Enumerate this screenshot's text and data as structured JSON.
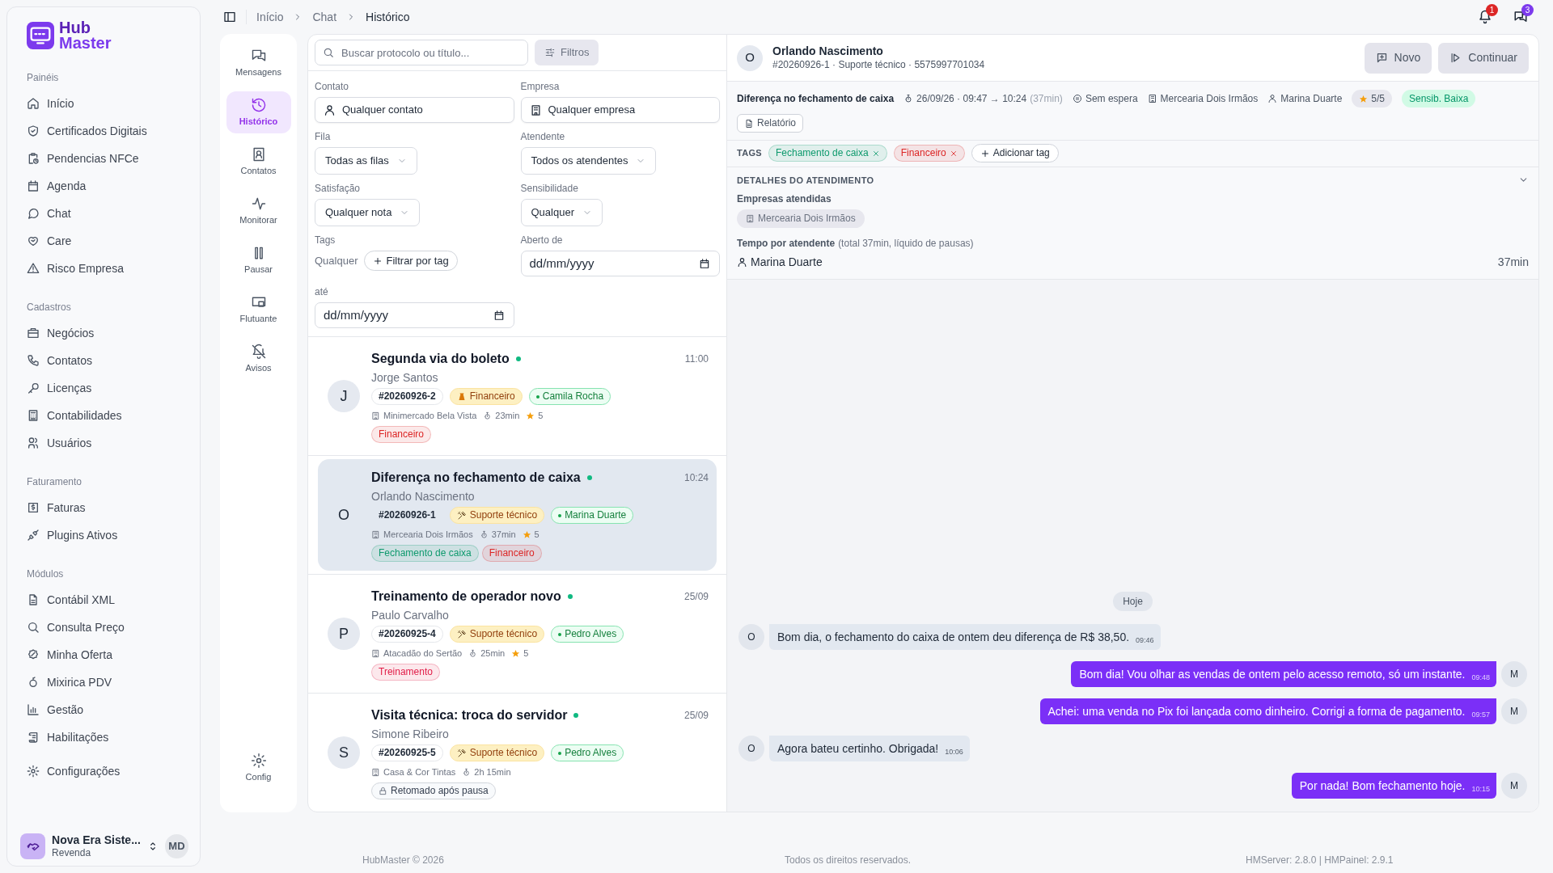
{
  "topbar": {
    "breadcrumbs": [
      "Início",
      "Chat",
      "Histórico"
    ],
    "notification_count": "1",
    "message_count": "3"
  },
  "sidebar": {
    "logo": {
      "line1": "Hub",
      "line2": "Master"
    },
    "sections": [
      {
        "title": "Painéis",
        "items": [
          "Início",
          "Certificados Digitais",
          "Pendencias NFCe",
          "Agenda",
          "Chat",
          "Care",
          "Risco Empresa"
        ]
      },
      {
        "title": "Cadastros",
        "items": [
          "Negócios",
          "Contatos",
          "Licenças",
          "Contabilidades",
          "Usuários"
        ]
      },
      {
        "title": "Faturamento",
        "items": [
          "Faturas",
          "Plugins Ativos"
        ]
      },
      {
        "title": "Módulos",
        "items": [
          "Contábil XML",
          "Consulta Preço",
          "Minha Oferta",
          "Mixirica PDV",
          "Gestão",
          "Habilitações"
        ]
      }
    ],
    "settings": "Configurações",
    "account": {
      "name": "Nova Era Siste...",
      "role": "Revenda",
      "initials": "MD"
    }
  },
  "rail": {
    "items": [
      {
        "label": "Mensagens",
        "selected": false
      },
      {
        "label": "Histórico",
        "selected": true
      },
      {
        "label": "Contatos",
        "selected": false
      },
      {
        "label": "Monitorar",
        "selected": false
      },
      {
        "label": "Pausar",
        "selected": false
      },
      {
        "label": "Flutuante",
        "selected": false
      },
      {
        "label": "Avisos",
        "selected": false
      }
    ],
    "settings": "Config"
  },
  "filters": {
    "search_placeholder": "Buscar protocolo ou título...",
    "filters_button": "Filtros",
    "contact": {
      "label": "Contato",
      "value": "Qualquer contato"
    },
    "company": {
      "label": "Empresa",
      "value": "Qualquer empresa"
    },
    "queue": {
      "label": "Fila",
      "value": "Todas as filas"
    },
    "agent": {
      "label": "Atendente",
      "value": "Todos os atendentes"
    },
    "satisfaction": {
      "label": "Satisfação",
      "value": "Qualquer nota"
    },
    "sensitivity": {
      "label": "Sensibilidade",
      "value": "Qualquer"
    },
    "tags": {
      "label": "Tags",
      "value": "Qualquer",
      "button": "Filtrar por tag"
    },
    "opened_from": {
      "label": "Aberto de",
      "placeholder": "dd/mm/yyyy"
    },
    "until": {
      "label": "até",
      "placeholder": "dd/mm/yyyy"
    }
  },
  "conversations": [
    {
      "avatar": "J",
      "title": "Segunda via do boleto",
      "online": true,
      "contact": "Jorge Santos",
      "time": "11:00",
      "protocol": "#20260926-2",
      "queue": {
        "kind": "finance",
        "label": "Financeiro"
      },
      "agent": "Camila Rocha",
      "company": "Minimercado Bela Vista",
      "duration": "23min",
      "rating": "5",
      "tags": [
        {
          "kind": "tag",
          "label": "Financeiro",
          "color": "#dc2626"
        }
      ],
      "selected": false
    },
    {
      "avatar": "O",
      "title": "Diferença no fechamento de caixa",
      "online": true,
      "contact": "Orlando Nascimento",
      "time": "10:24",
      "protocol": "#20260926-1",
      "queue": {
        "kind": "support",
        "label": "Suporte técnico"
      },
      "agent": "Marina Duarte",
      "company": "Mercearia Dois Irmãos",
      "duration": "37min",
      "rating": "5",
      "tags": [
        {
          "kind": "tag",
          "label": "Fechamento de caixa",
          "color": "#0f9a6e"
        },
        {
          "kind": "tag",
          "label": "Financeiro",
          "color": "#dc2626"
        }
      ],
      "selected": true
    },
    {
      "avatar": "P",
      "title": "Treinamento de operador novo",
      "online": true,
      "contact": "Paulo Carvalho",
      "time": "25/09",
      "protocol": "#20260925-4",
      "queue": {
        "kind": "support",
        "label": "Suporte técnico"
      },
      "agent": "Pedro Alves",
      "company": "Atacadão do Sertão",
      "duration": "25min",
      "rating": "5",
      "tags": [
        {
          "kind": "tag",
          "label": "Treinamento",
          "color": "#e11d48"
        }
      ],
      "selected": false
    },
    {
      "avatar": "S",
      "title": "Visita técnica: troca do servidor",
      "online": true,
      "contact": "Simone Ribeiro",
      "time": "25/09",
      "protocol": "#20260925-5",
      "queue": {
        "kind": "support",
        "label": "Suporte técnico"
      },
      "agent": "Pedro Alves",
      "company": "Casa & Cor Tintas",
      "duration": "2h 15min",
      "tags": [
        {
          "kind": "status",
          "label": "Retomado após pausa",
          "color": "#374151"
        }
      ],
      "selected": false
    }
  ],
  "detail": {
    "avatar": "O",
    "name": "Orlando Nascimento",
    "subtitle": "#20260926-1 · Suporte técnico · 5575997701034",
    "new_button": "Novo",
    "continue_button": "Continuar",
    "title": "Diferença no fechamento de caixa",
    "period": "26/09/26 · 09:47 → 10:24",
    "period_duration": "(37min)",
    "wait": "Sem espera",
    "company": "Mercearia Dois Irmãos",
    "agent": "Marina Duarte",
    "rating": "5/5",
    "sensitivity": "Sensib. Baixa",
    "report_button": "Relatório",
    "tags_label": "TAGS",
    "tags": [
      {
        "label": "Fechamento de caixa",
        "color": "#0f9a6e"
      },
      {
        "label": "Financeiro",
        "color": "#dc2626"
      }
    ],
    "add_tag": "Adicionar tag",
    "details": {
      "title": "DETALHES DO ATENDIMENTO",
      "expanded": true,
      "companies_label": "Empresas atendidas",
      "companies": [
        "Mercearia Dois Irmãos"
      ],
      "time_label": "Tempo por atendente",
      "time_note": "(total 37min, líquido de pausas)",
      "agents": [
        {
          "name": "Marina Duarte",
          "time": "37min"
        }
      ]
    }
  },
  "chat": {
    "date": "Hoje",
    "messages": [
      {
        "kind": "incoming",
        "avatar": "O",
        "text": "Bom dia, o fechamento do caixa de ontem deu diferença de R$ 38,50.",
        "time": "09:46"
      },
      {
        "kind": "outgoing",
        "avatar": "M",
        "text": "Bom dia! Vou olhar as vendas de ontem pelo acesso remoto, só um instante.",
        "time": "09:48"
      },
      {
        "kind": "outgoing",
        "avatar": "M",
        "text": "Achei: uma venda no Pix foi lançada como dinheiro. Corrigi a forma de pagamento.",
        "time": "09:57"
      },
      {
        "kind": "incoming",
        "avatar": "O",
        "text": "Agora bateu certinho. Obrigada!",
        "time": "10:06"
      },
      {
        "kind": "outgoing",
        "avatar": "M",
        "text": "Por nada! Bom fechamento hoje.",
        "time": "10:15"
      }
    ]
  },
  "footer": {
    "left": "HubMaster © 2026",
    "center": "Todos os direitos reservados.",
    "right": "HMServer: 2.8.0 | HMPainel: 2.9.1"
  }
}
